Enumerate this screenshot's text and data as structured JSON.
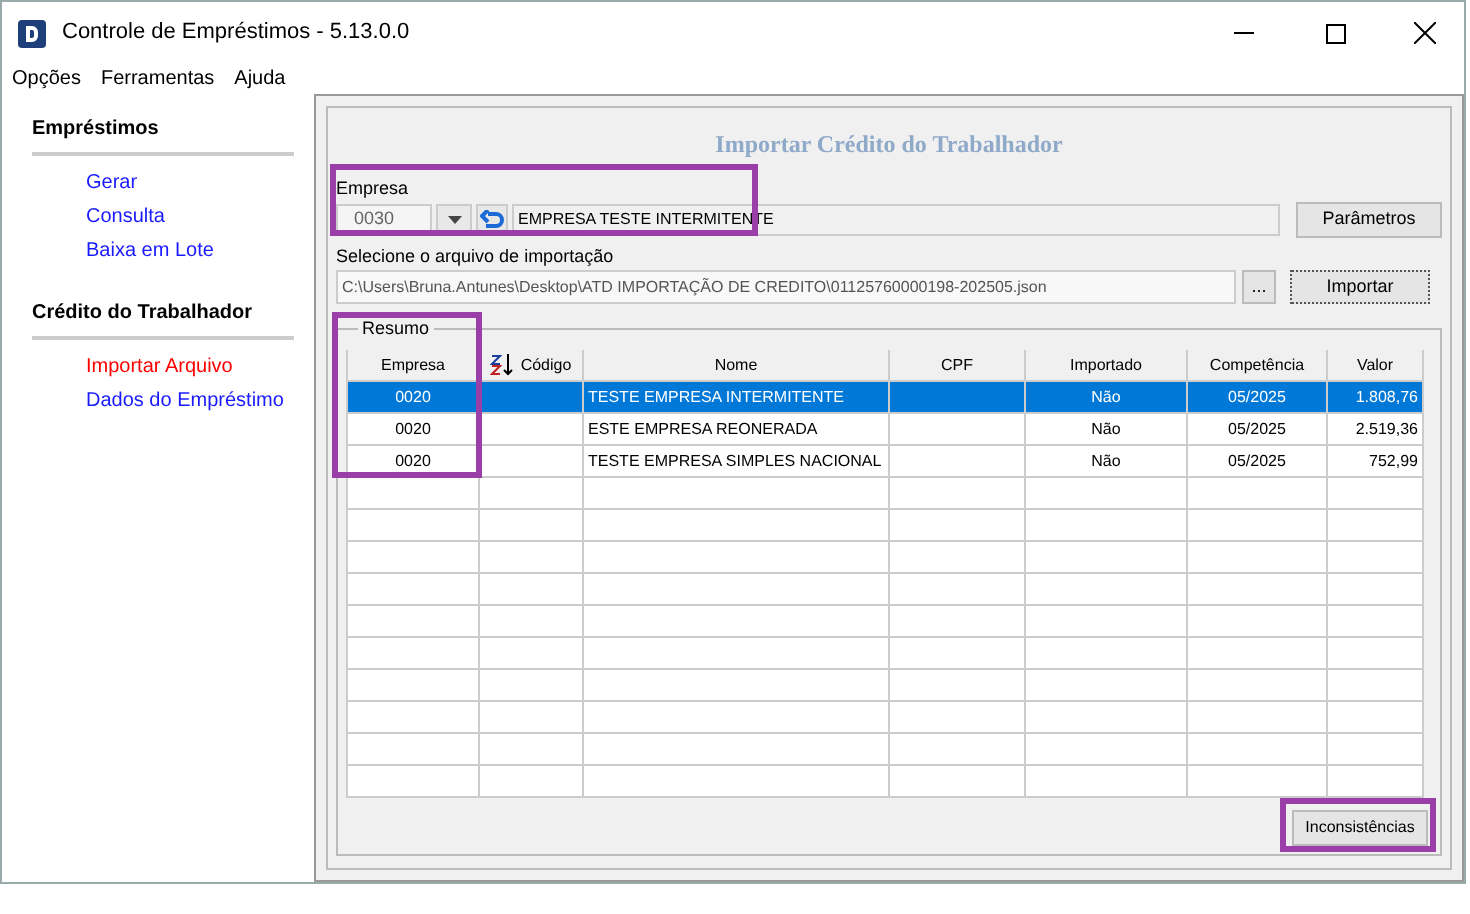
{
  "window": {
    "title": "Controle de Empréstimos - 5.13.0.0"
  },
  "menu": [
    "Opções",
    "Ferramentas",
    "Ajuda"
  ],
  "sidebar": [
    {
      "title": "Empréstimos",
      "items": [
        {
          "label": "Gerar",
          "selected": false
        },
        {
          "label": "Consulta",
          "selected": false
        },
        {
          "label": "Baixa em Lote",
          "selected": false
        }
      ]
    },
    {
      "title": "Crédito do Trabalhador",
      "items": [
        {
          "label": "Importar Arquivo",
          "selected": true
        },
        {
          "label": "Dados do Empréstimo",
          "selected": false
        }
      ]
    }
  ],
  "page_title": "Importar Crédito do Trabalhador",
  "empresa": {
    "label": "Empresa",
    "code": "0030",
    "name": "EMPRESA TESTE INTERMITENTE"
  },
  "parametros_button": "Parâmetros",
  "file": {
    "label": "Selecione o arquivo de importação",
    "value": "C:\\Users\\Bruna.Antunes\\Desktop\\ATD IMPORTAÇÃO DE CREDITO\\01125760000198-202505.json",
    "browse": "...",
    "import_button": "Importar"
  },
  "resumo": {
    "title": "Resumo",
    "columns": [
      "Empresa",
      "Código",
      "Nome",
      "CPF",
      "Importado",
      "Competência",
      "Valor"
    ],
    "rows": [
      {
        "empresa": "0020",
        "nome": "TESTE EMPRESA INTERMITENTE",
        "importado": "Não",
        "competencia": "05/2025",
        "valor": "1.808,76",
        "selected": true
      },
      {
        "empresa": "0020",
        "nome": "ESTE EMPRESA REONERADA",
        "importado": "Não",
        "competencia": "05/2025",
        "valor": "2.519,36",
        "selected": false
      },
      {
        "empresa": "0020",
        "nome": "TESTE EMPRESA SIMPLES NACIONAL",
        "importado": "Não",
        "competencia": "05/2025",
        "valor": "752,99",
        "selected": false
      }
    ]
  },
  "inconsistencias_button": "Inconsistências"
}
